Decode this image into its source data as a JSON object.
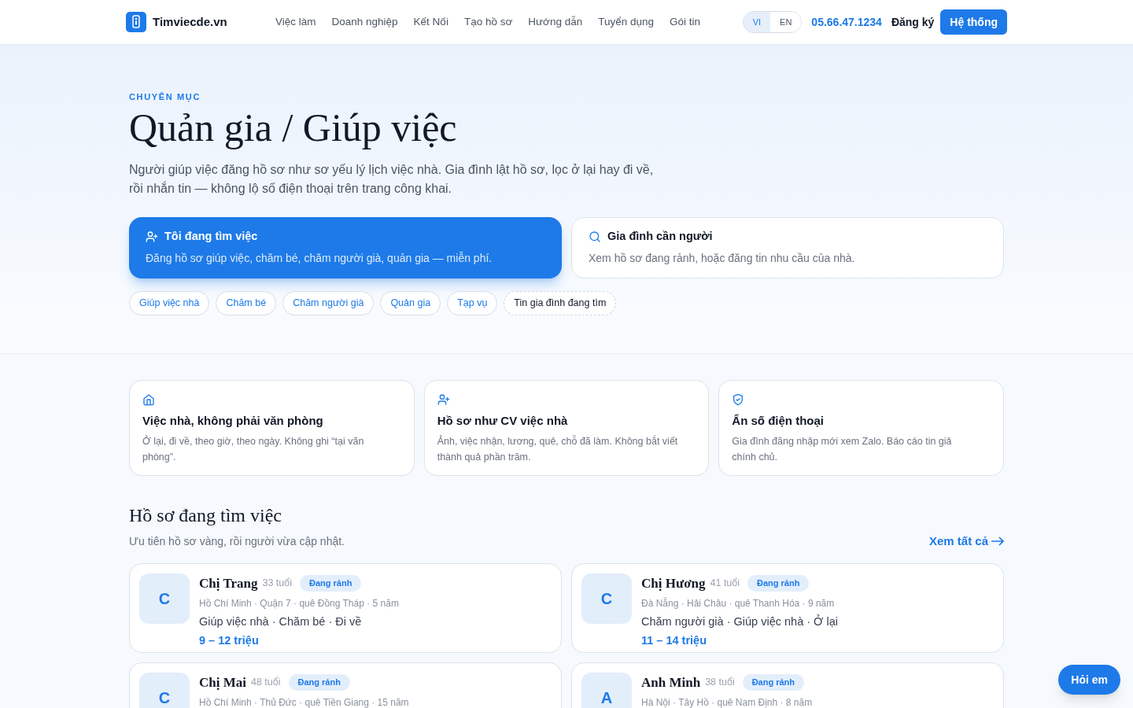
{
  "header": {
    "brand": "Timviecde.vn",
    "nav": [
      "Việc làm",
      "Doanh nghiệp",
      "Kết Nối",
      "Tạo hồ sơ",
      "Hướng dẫn",
      "Tuyển dụng",
      "Gói tin"
    ],
    "languages": [
      {
        "label": "VI",
        "selected": true
      },
      {
        "label": "EN",
        "selected": false
      }
    ],
    "phone": "05.66.47.1234",
    "register": "Đăng ký",
    "system_button": "Hệ thống"
  },
  "hero": {
    "eyebrow": "CHUYÊN MỤC",
    "title": "Quản gia / Giúp việc",
    "description": "Người giúp việc đăng hồ sơ như sơ yếu lý lịch việc nhà. Gia đình lật hồ sơ, lọc ở lại hay đi về, rồi nhắn tin — không lộ số điện thoại trên trang công khai.",
    "modes": [
      {
        "title": "Tôi đang tìm việc",
        "subtitle": "Đăng hồ sơ giúp việc, chăm bé, chăm người già, quản gia — miễn phí.",
        "selected": true,
        "kind": "user"
      },
      {
        "title": "Gia đình cần người",
        "subtitle": "Xem hồ sơ đang rảnh, hoặc đăng tin nhu cầu của nhà.",
        "selected": false,
        "kind": "search"
      }
    ],
    "chips": [
      {
        "label": "Giúp việc nhà",
        "kind": "category"
      },
      {
        "label": "Chăm bé",
        "kind": "category"
      },
      {
        "label": "Chăm người già",
        "kind": "category"
      },
      {
        "label": "Quản gia",
        "kind": "category"
      },
      {
        "label": "Tạp vụ",
        "kind": "category"
      },
      {
        "label": "Tin gia đình đang tìm",
        "kind": "dashed"
      }
    ]
  },
  "features": [
    {
      "kind": "home",
      "title": "Việc nhà, không phải văn phòng",
      "text": "Ở lại, đi về, theo giờ, theo ngày. Không ghi “tại văn phòng”."
    },
    {
      "kind": "user",
      "title": "Hồ sơ như CV việc nhà",
      "text": "Ảnh, việc nhận, lương, quê, chỗ đã làm. Không bắt viết thành quả phần trăm."
    },
    {
      "kind": "shield",
      "title": "Ẩn số điện thoại",
      "text": "Gia đình đăng nhập mới xem Zalo. Báo cáo tin giả chính chủ."
    }
  ],
  "profiles_section": {
    "title": "Hồ sơ đang tìm việc",
    "subtitle": "Ưu tiên hồ sơ vàng, rồi người vừa cập nhật.",
    "see_all": "Xem tất cả",
    "profiles": [
      {
        "initial": "C",
        "name": "Chị Trang",
        "age": "33 tuổi",
        "status": "Đang rảnh",
        "meta": "Hồ Chí Minh · Quận 7 · quê Đồng Tháp · 5 năm",
        "skills": "Giúp việc nhà · Chăm bé · Đi về",
        "salary": "9 – 12 triệu"
      },
      {
        "initial": "C",
        "name": "Chị Hương",
        "age": "41 tuổi",
        "status": "Đang rảnh",
        "meta": "Đà Nẵng · Hải Châu · quê Thanh Hóa · 9 năm",
        "skills": "Chăm người già · Giúp việc nhà · Ở lại",
        "salary": "11 – 14 triệu"
      },
      {
        "initial": "C",
        "name": "Chị Mai",
        "age": "48 tuổi",
        "status": "Đang rảnh",
        "meta": "Hồ Chí Minh · Thủ Đức · quê Tiền Giang · 15 năm"
      },
      {
        "initial": "A",
        "name": "Anh Minh",
        "age": "38 tuổi",
        "status": "Đang rảnh",
        "meta": "Hà Nội · Tây Hồ · quê Nam Định · 8 năm"
      }
    ]
  },
  "chat_button": "Hỏi em"
}
